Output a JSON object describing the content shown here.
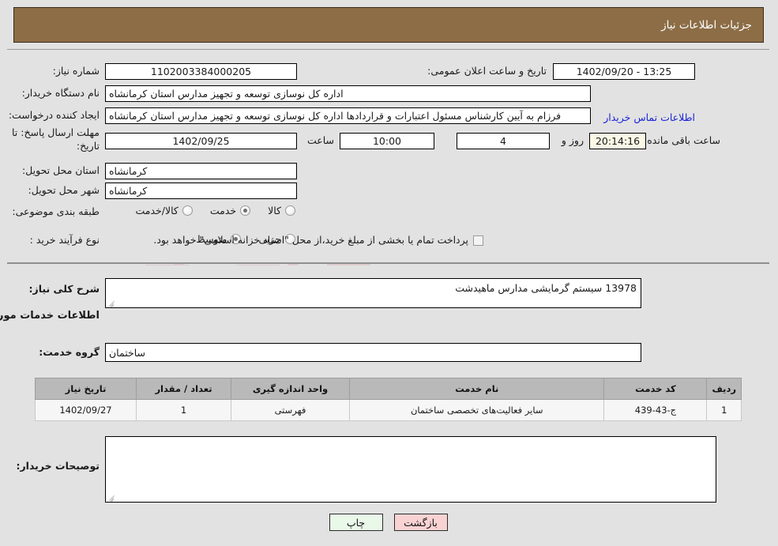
{
  "header": {
    "title": "جزئیات اطلاعات نیاز"
  },
  "details": {
    "need_number": {
      "label": "شماره نیاز:",
      "value": "1102003384000205"
    },
    "buyer_org": {
      "label": "نام دستگاه خریدار:",
      "value": "اداره کل نوسازی  توسعه و تجهیز مدارس استان کرمانشاه"
    },
    "request_creator": {
      "label": "ایجاد کننده درخواست:",
      "value": "فرزام به آیین کارشناس مسئول اعتبارات و قراردادها اداره کل نوسازی  توسعه و تجهیز مدارس استان کرمانشاه",
      "link_label": "اطلاعات تماس خریدار"
    },
    "public_announce": {
      "label": "تاریخ و ساعت اعلان عمومی:",
      "value": "13:25 - 1402/09/20"
    },
    "deadline": {
      "label": "مهلت ارسال پاسخ: تا تاریخ:",
      "date": "1402/09/25",
      "time_label": "ساعت",
      "time": "10:00",
      "days": "4",
      "days_label": "روز و",
      "remaining": "20:14:16",
      "remaining_label": "ساعت باقی مانده"
    },
    "delivery_province": {
      "label": "استان محل تحویل:",
      "value": "کرمانشاه"
    },
    "delivery_city": {
      "label": "شهر محل تحویل:",
      "value": "کرمانشاه"
    },
    "subject_category": {
      "label": "طبقه بندی موضوعی:",
      "options": [
        {
          "label": "کالا",
          "selected": false
        },
        {
          "label": "خدمت",
          "selected": true
        },
        {
          "label": "کالا/خدمت",
          "selected": false
        }
      ]
    },
    "purchase_process": {
      "label": "نوع فرآیند خرید :",
      "options": [
        {
          "label": "جزیی",
          "selected": false
        },
        {
          "label": "متوسط",
          "selected": true
        }
      ],
      "checkbox": {
        "label": "پرداخت تمام یا بخشی از مبلغ خرید،از محل \"اسناد خزانه اسلامی\" خواهد بود.",
        "checked": false
      }
    }
  },
  "need_summary": {
    "label": "شرح کلی نیاز:",
    "value": "13978 سیستم گرمایشی مدارس ماهیدشت"
  },
  "services_section": {
    "heading": "اطلاعات خدمات مورد نیاز",
    "service_group": {
      "label": "گروه خدمت:",
      "value": "ساختمان"
    },
    "table": {
      "columns": [
        "ردیف",
        "کد خدمت",
        "نام خدمت",
        "واحد اندازه گیری",
        "تعداد / مقدار",
        "تاریخ نیاز"
      ],
      "rows": [
        [
          "1",
          "ج-43-439",
          "سایر فعالیت‌های تخصصی ساختمان",
          "فهرستی",
          "1",
          "1402/09/27"
        ]
      ]
    }
  },
  "buyer_notes": {
    "label": "توصیحات خریدار:",
    "value": ""
  },
  "footer": {
    "back_button": "بازگشت",
    "print_button": "چاپ"
  },
  "watermark": {
    "text": "AriaTender.net"
  },
  "colors": {
    "header_bg": "#8c6d46",
    "page_bg": "#e2e2e2",
    "link": "#1923d8",
    "table_header_bg": "#b9b9b9",
    "back_button_bg": "#f9d3d3",
    "print_button_bg": "#e9f8e9",
    "countdown_field_bg": "#fbf8e6"
  }
}
